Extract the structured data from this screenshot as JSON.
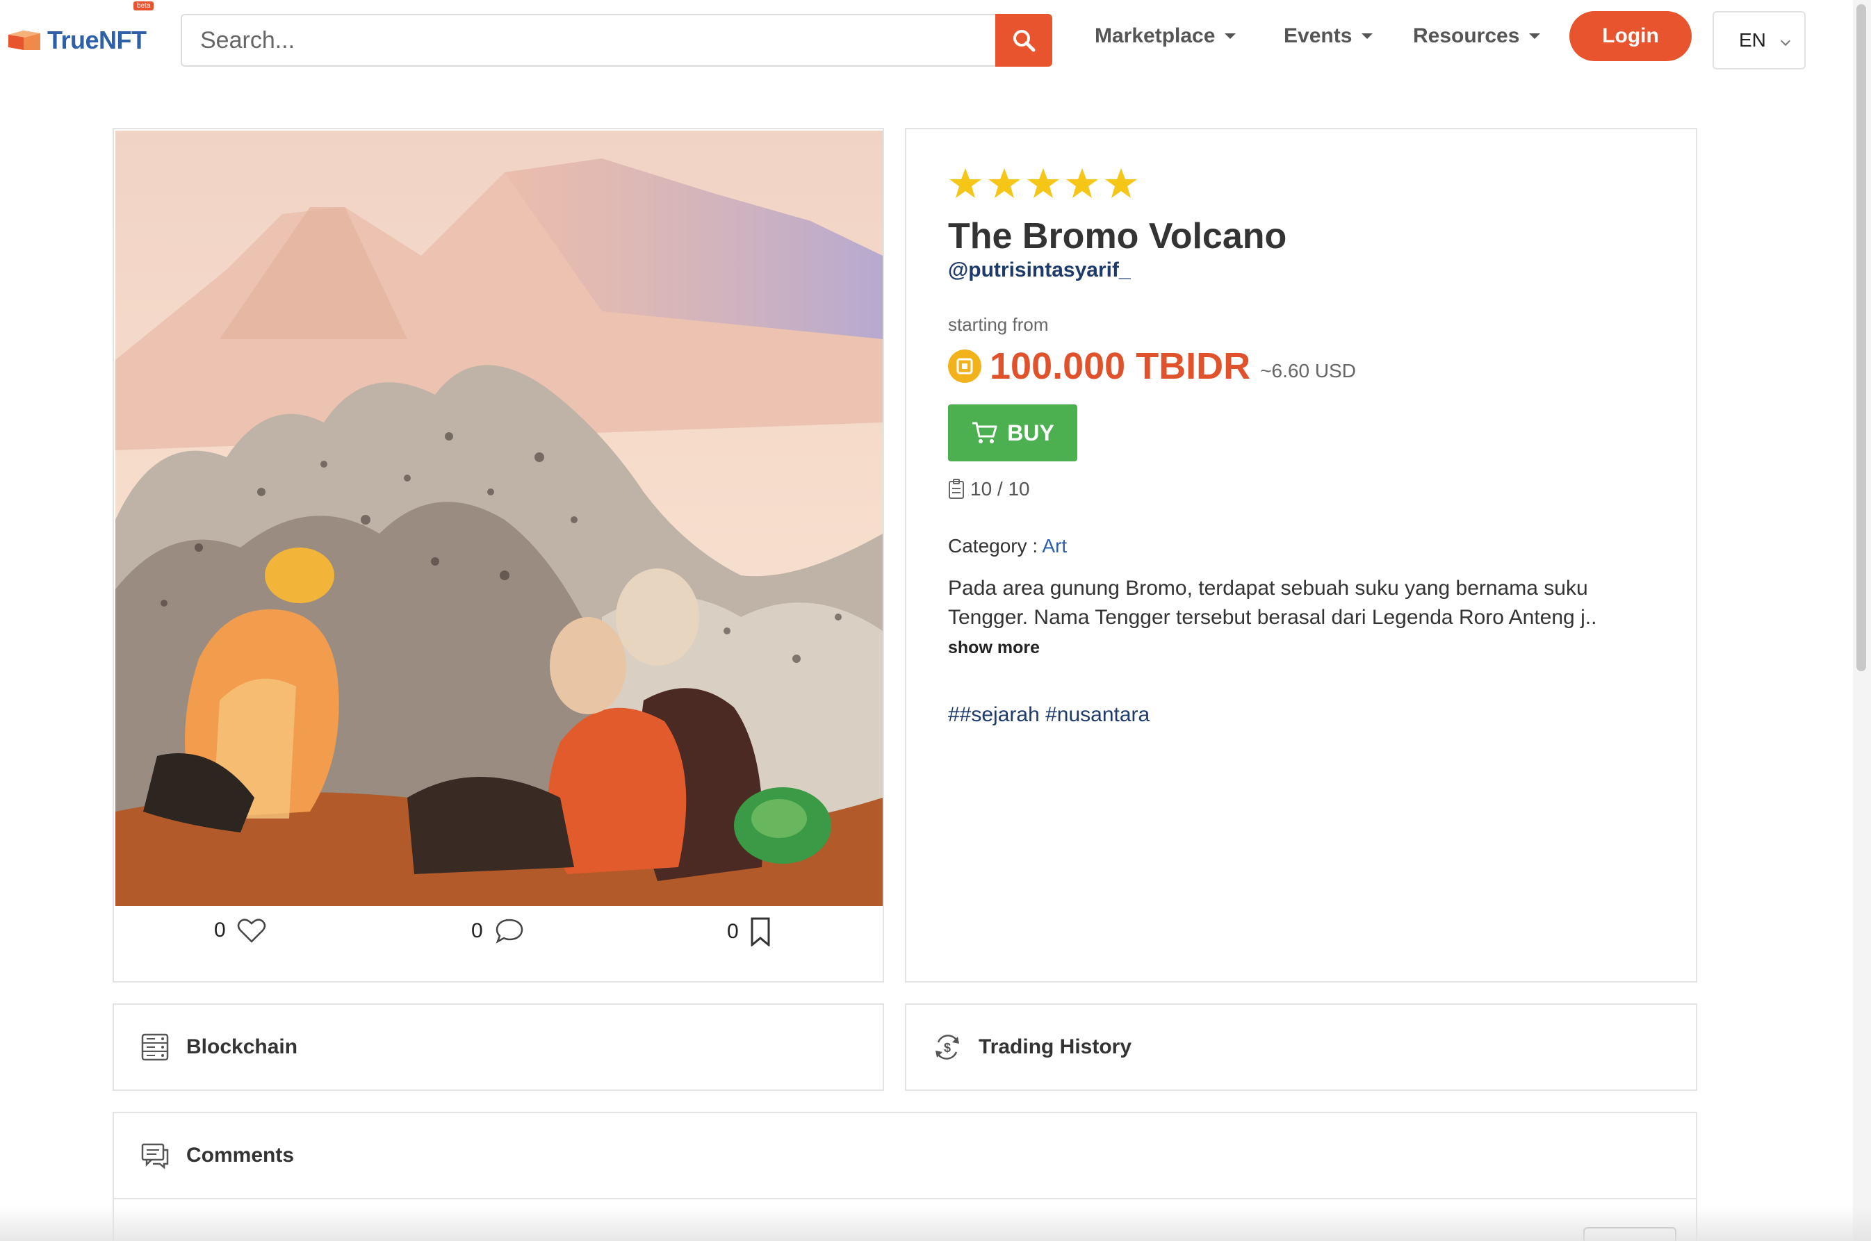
{
  "brand": {
    "name": "TrueNFT",
    "badge": "beta",
    "accent": "#e8542e"
  },
  "search": {
    "placeholder": "Search..."
  },
  "nav": {
    "items": [
      {
        "label": "Marketplace"
      },
      {
        "label": "Events"
      },
      {
        "label": "Resources"
      }
    ],
    "login_label": "Login",
    "language": "EN"
  },
  "nft": {
    "rating_stars": 5,
    "title": "The Bromo Volcano",
    "creator": "@putrisintasyarif_",
    "starting_label": "starting from",
    "price": "100.000 TBIDR",
    "price_usd": "~6.60 USD",
    "buy_label": "BUY",
    "supply": "10 / 10",
    "category_label": "Category :",
    "category_value": "Art",
    "description": "Pada area gunung Bromo, terdapat sebuah suku yang bernama suku Tengger. Nama Tengger tersebut berasal dari Legenda Roro Anteng j..",
    "show_more": "show more",
    "tags": "##sejarah #nusantara",
    "likes": "0",
    "comments": "0",
    "bookmarks": "0"
  },
  "sections": {
    "blockchain": "Blockchain",
    "trading_history": "Trading History",
    "comments": "Comments"
  },
  "colors": {
    "price": "#e0522b",
    "buy": "#4caf50",
    "star": "#f5c518",
    "link": "#1e3a6b"
  }
}
